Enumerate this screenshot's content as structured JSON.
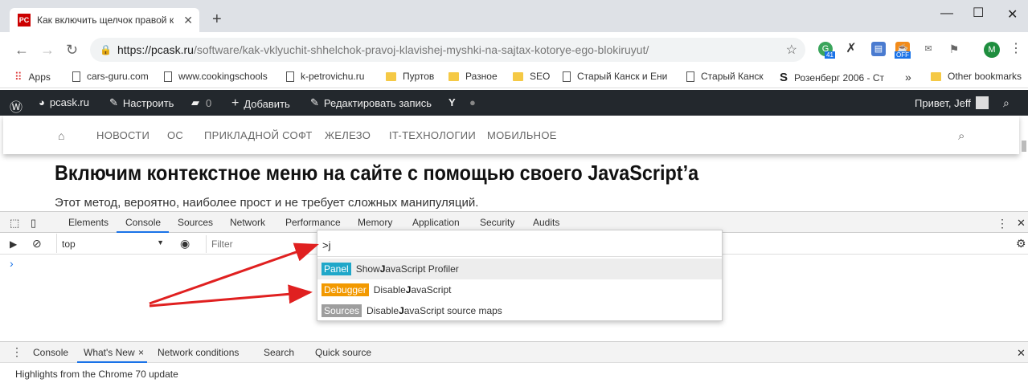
{
  "browser": {
    "tab_title": "Как включить щелчок правой к",
    "tab_favicon": "PC",
    "url_domain": "https://pcask.ru",
    "url_path": "/software/kak-vklyuchit-shhelchok-pravoj-klavishej-myshki-na-sajtax-kotorye-ego-blokiruyut/",
    "ext_badge_1": "41",
    "ext_badge_2": "OFF",
    "profile_letter": "M"
  },
  "bookmarks": {
    "items": [
      "Apps",
      "cars-guru.com",
      "www.cookingschools",
      "k-petrovichu.ru",
      "Пуртов",
      "Разное",
      "SEO",
      "Старый Канск и Ени",
      "Старый Канск",
      "Розенберг 2006 - Ст"
    ],
    "more": "»",
    "other": "Other bookmarks"
  },
  "wpadmin": {
    "site": "pcask.ru",
    "customize": "Настроить",
    "comments": "0",
    "add": "Добавить",
    "edit": "Редактировать запись",
    "greeting": "Привет, Jeff"
  },
  "sitenav": {
    "items": [
      "НОВОСТИ",
      "ОС",
      "ПРИКЛАДНОЙ СОФТ",
      "ЖЕЛЕЗО",
      "IT-ТЕХНОЛОГИИ",
      "МОБИЛЬНОЕ"
    ]
  },
  "article": {
    "heading": "Включим контекстное меню на сайте с помощью своего JavaScript’а",
    "paragraph": "Этот метод, вероятно, наиболее прост и не требует сложных манипуляций."
  },
  "devtools": {
    "tabs": [
      "Elements",
      "Console",
      "Sources",
      "Network",
      "Performance",
      "Memory",
      "Application",
      "Security",
      "Audits"
    ],
    "context": "top",
    "filter_placeholder": "Filter",
    "prompt": "›"
  },
  "command_menu": {
    "input": ">j",
    "items": [
      {
        "badge": "Panel",
        "badge_color": "#1fa7c9",
        "pre": "Show ",
        "match": "J",
        "post": "avaScript Profiler"
      },
      {
        "badge": "Debugger",
        "badge_color": "#f29900",
        "pre": "Disable ",
        "match": "J",
        "post": "avaScript"
      },
      {
        "badge": "Sources",
        "badge_color": "#9e9e9e",
        "pre": "Disable ",
        "match": "J",
        "post": "avaScript source maps"
      }
    ]
  },
  "drawer": {
    "tabs": [
      "Console",
      "What's New",
      "Network conditions",
      "Search",
      "Quick source"
    ],
    "close": "×",
    "status": "Highlights from the Chrome 70 update"
  },
  "colors": {
    "arrow": "#e02020",
    "accent": "#1a73e8"
  }
}
